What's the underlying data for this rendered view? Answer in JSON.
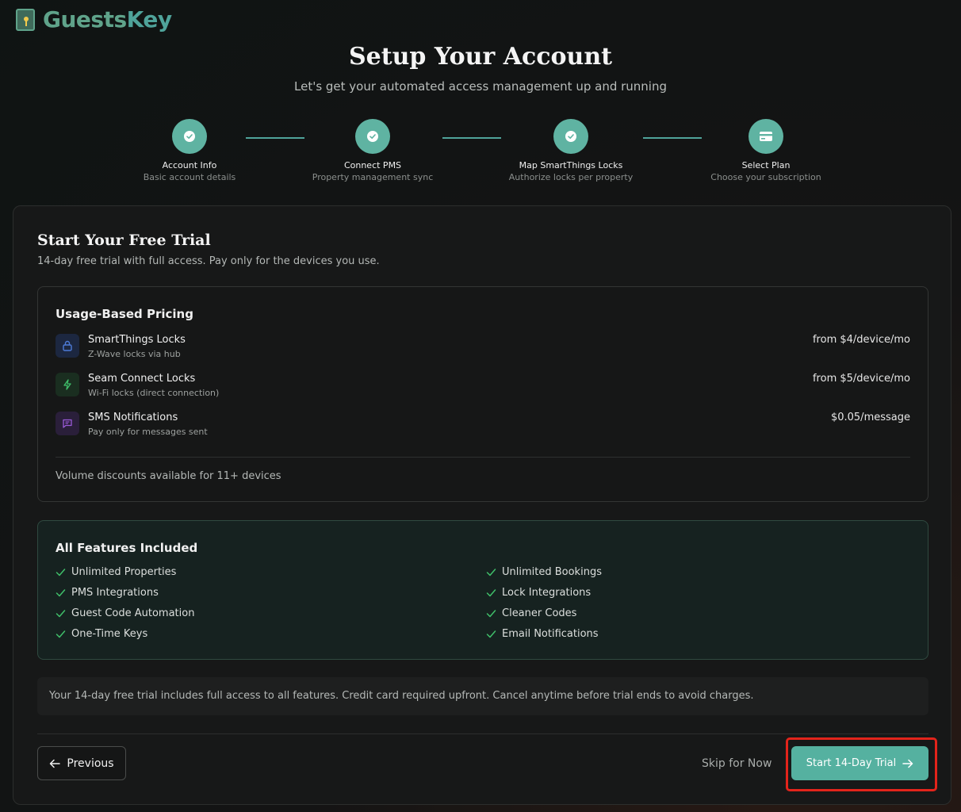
{
  "brand": {
    "name_part1": "Guests",
    "name_part2": "Key"
  },
  "header": {
    "title": "Setup Your Account",
    "subtitle": "Let's get your automated access management up and running"
  },
  "steps": [
    {
      "title": "Account Info",
      "desc": "Basic account details",
      "status": "completed",
      "icon": "check-icon"
    },
    {
      "title": "Connect PMS",
      "desc": "Property management sync",
      "status": "completed",
      "icon": "check-icon"
    },
    {
      "title": "Map SmartThings Locks",
      "desc": "Authorize locks per property",
      "status": "completed",
      "icon": "check-icon"
    },
    {
      "title": "Select Plan",
      "desc": "Choose your subscription",
      "status": "current",
      "icon": "credit-card-icon"
    }
  ],
  "trial": {
    "title": "Start Your Free Trial",
    "subtitle": "14-day free trial with full access. Pay only for the devices you use."
  },
  "pricing": {
    "title": "Usage-Based Pricing",
    "items": [
      {
        "name": "SmartThings Locks",
        "desc": "Z-Wave locks via hub",
        "price": "from $4/device/mo",
        "icon": "lock-icon",
        "color": "#4d7bd8"
      },
      {
        "name": "Seam Connect Locks",
        "desc": "Wi-Fi locks (direct connection)",
        "price": "from $5/device/mo",
        "icon": "lightning-icon",
        "color": "#3fbf6a"
      },
      {
        "name": "SMS Notifications",
        "desc": "Pay only for messages sent",
        "price": "$0.05/message",
        "icon": "message-icon",
        "color": "#9a5ad8"
      }
    ],
    "note": "Volume discounts available for 11+ devices"
  },
  "features": {
    "title": "All Features Included",
    "left": [
      "Unlimited Properties",
      "PMS Integrations",
      "Guest Code Automation",
      "One-Time Keys"
    ],
    "right": [
      "Unlimited Bookings",
      "Lock Integrations",
      "Cleaner Codes",
      "Email Notifications"
    ]
  },
  "notice": "Your 14-day free trial includes full access to all features. Credit card required upfront. Cancel anytime before trial ends to avoid charges.",
  "actions": {
    "previous": "Previous",
    "skip": "Skip for Now",
    "start": "Start 14-Day Trial"
  },
  "colors": {
    "accent": "#55b1a0",
    "highlight": "#e3241b"
  }
}
